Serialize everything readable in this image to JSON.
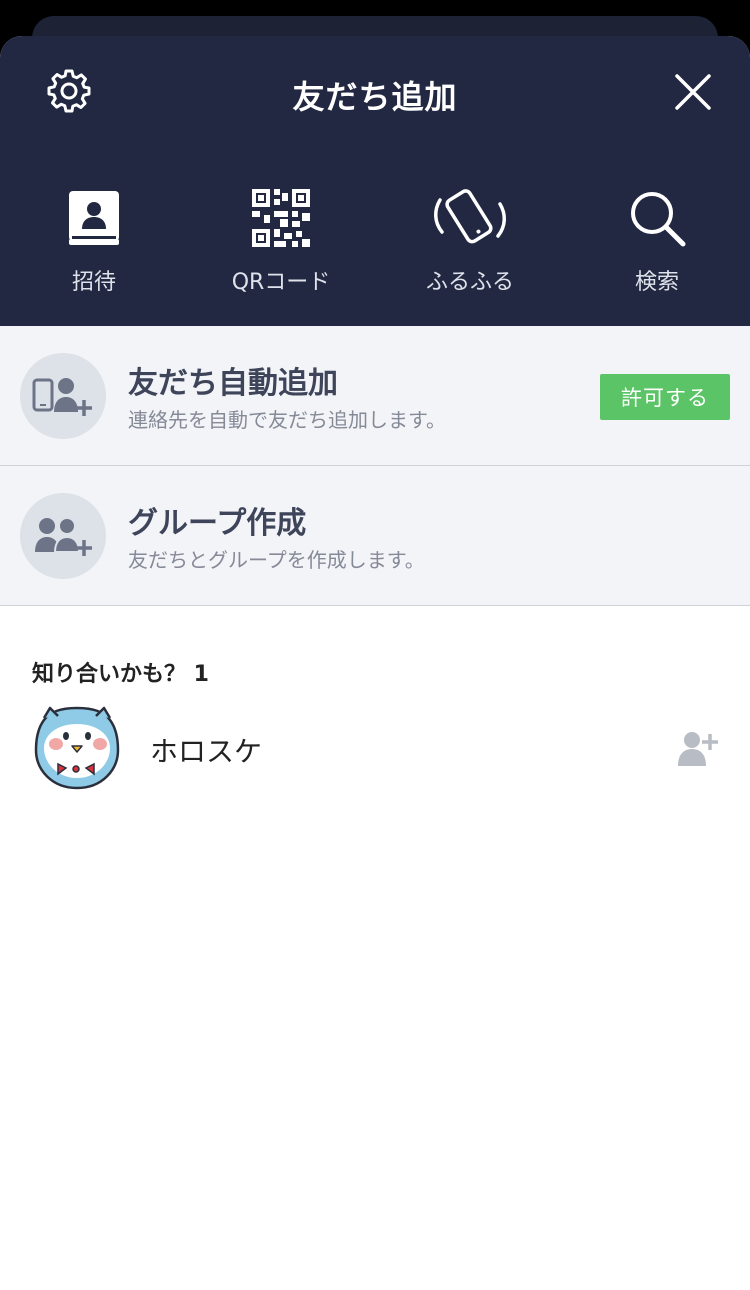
{
  "header": {
    "title": "友だち追加",
    "actions": [
      {
        "label": "招待",
        "icon": "contact-book-icon"
      },
      {
        "label": "QRコード",
        "icon": "qr-code-icon"
      },
      {
        "label": "ふるふる",
        "icon": "shake-phone-icon"
      },
      {
        "label": "検索",
        "icon": "search-icon"
      }
    ]
  },
  "auto_add": {
    "title": "友だち自動追加",
    "subtitle": "連絡先を自動で友だち追加します。",
    "button": "許可する"
  },
  "group": {
    "title": "グループ作成",
    "subtitle": "友だちとグループを作成します。"
  },
  "suggestions": {
    "title": "知り合いかも？ 1",
    "items": [
      {
        "name": "ホロスケ"
      }
    ]
  },
  "colors": {
    "header_bg": "#222841",
    "accent_green": "#5bc467",
    "row_bg": "#f3f4f7"
  }
}
